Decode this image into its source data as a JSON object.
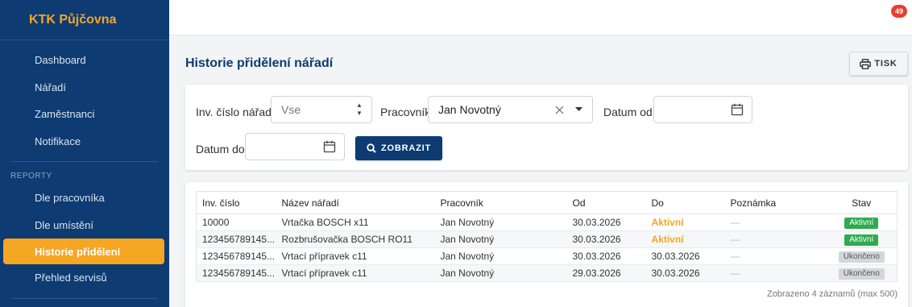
{
  "sidebar": {
    "brand": "KTK Půjčovna",
    "items": [
      {
        "label": "Dashboard"
      },
      {
        "label": "Nářadí"
      },
      {
        "label": "Zaměstnanci"
      },
      {
        "label": "Notifikace"
      }
    ],
    "section_label": "REPORTY",
    "report_items": [
      {
        "label": "Dle pracovníka"
      },
      {
        "label": "Dle umístění"
      },
      {
        "label": "Historie přidělení",
        "active": true
      },
      {
        "label": "Přehled servisů"
      }
    ]
  },
  "topbar": {
    "notification_count": "49"
  },
  "page": {
    "title": "Historie přidělení nářadí",
    "print_label": "TISK"
  },
  "filters": {
    "inv_label": "Inv. číslo nářadí",
    "inv_placeholder": "Vse",
    "worker_label": "Pracovník",
    "worker_value": "Jan Novotný",
    "date_from_label": "Datum od",
    "date_to_label": "Datum do",
    "show_label": "ZOBRAZIT"
  },
  "table": {
    "headers": [
      "Inv. číslo",
      "Název nářadí",
      "Pracovník",
      "Od",
      "Do",
      "Poznámka",
      "Stav"
    ],
    "rows": [
      {
        "inv": "10000",
        "name": "Vrtačka BOSCH x11",
        "worker": "Jan Novotný",
        "od": "30.03.2026",
        "do": "Aktivní",
        "note": "—",
        "stav": "Aktivní"
      },
      {
        "inv": "123456789145...",
        "name": "Rozbrušovačka BOSCH RO11",
        "worker": "Jan Novotný",
        "od": "30.03.2026",
        "do": "Aktivní",
        "note": "—",
        "stav": "Aktivní"
      },
      {
        "inv": "123456789145...",
        "name": "Vrtací přípravek c11",
        "worker": "Jan Novotný",
        "od": "30.03.2026",
        "do": "30.03.2026",
        "note": "—",
        "stav": "Ukončeno"
      },
      {
        "inv": "123456789145...",
        "name": "Vrtací přípravek c11",
        "worker": "Jan Novotný",
        "od": "29.03.2026",
        "do": "30.03.2026",
        "note": "—",
        "stav": "Ukončeno"
      }
    ],
    "footer": "Zobrazeno 4 záznamů (max 500)"
  },
  "colors": {
    "sidebar_bg": "#0d3b72",
    "accent": "#f5a623",
    "status_active": "#2eaa4f",
    "status_ended": "#d3d6da",
    "badge": "#e5412d"
  }
}
